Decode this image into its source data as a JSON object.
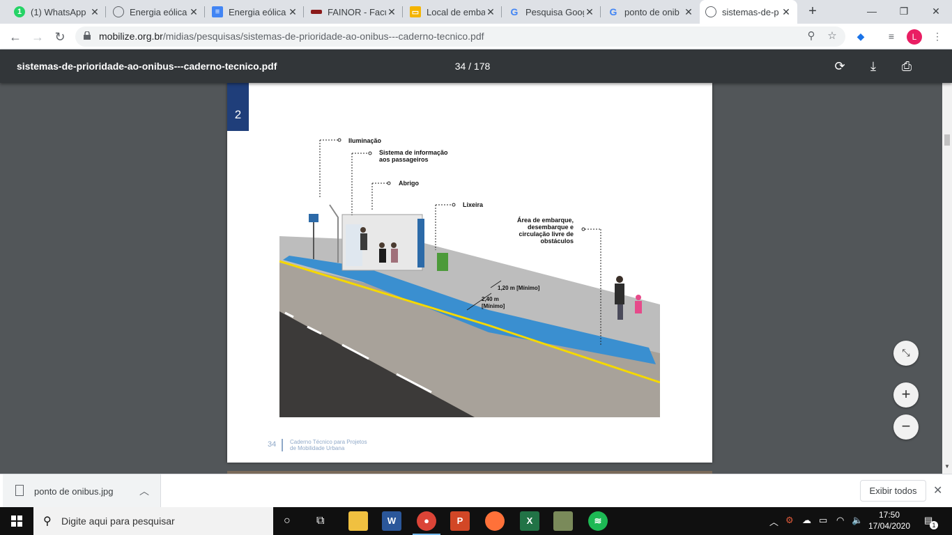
{
  "tabs": [
    {
      "title": "(1) WhatsApp",
      "icon": "whatsapp-icon",
      "color": "#25d366",
      "badge": "1"
    },
    {
      "title": "Energia eólica",
      "icon": "globe-icon",
      "color": "#5f6368",
      "badge": ""
    },
    {
      "title": "Energia eólica",
      "icon": "docs-icon",
      "color": "#4285f4",
      "badge": ""
    },
    {
      "title": "FAINOR - Facu",
      "icon": "fainor-icon",
      "color": "#8b1a1a",
      "badge": ""
    },
    {
      "title": "Local de emba",
      "icon": "slides-icon",
      "color": "#f4b400",
      "badge": ""
    },
    {
      "title": "Pesquisa Goog",
      "icon": "google-icon",
      "color": "#4285f4",
      "badge": ""
    },
    {
      "title": "ponto de onib",
      "icon": "google-icon",
      "color": "#4285f4",
      "badge": ""
    },
    {
      "title": "sistemas-de-p",
      "icon": "globe-icon",
      "color": "#5f6368",
      "badge": ""
    }
  ],
  "address": {
    "domain": "mobilize.org.br",
    "path": "/midias/pesquisas/sistemas-de-prioridade-ao-onibus---caderno-tecnico.pdf"
  },
  "avatar_letter": "L",
  "pdf": {
    "title": "sistemas-de-prioridade-ao-onibus---caderno-tecnico.pdf",
    "page_indicator": "34 / 178"
  },
  "document": {
    "chapter": "2",
    "labels": {
      "iluminacao": "Iluminação",
      "sistema_l1": "Sistema de informação",
      "sistema_l2": "aos passageiros",
      "abrigo": "Abrigo",
      "lixeira": "Lixeira",
      "area_l1": "Área de embarque,",
      "area_l2": "desembarque e",
      "area_l3": "circulação livre de",
      "area_l4": "obstáculos",
      "dim1": "1,20 m [Mínimo]",
      "dim2_l1": "2,40 m",
      "dim2_l2": "[Mínimo]"
    },
    "page_number": "34",
    "footer_l1": "Caderno Técnico para Projetos",
    "footer_l2": "de Mobilidade Urbana"
  },
  "download": {
    "filename": "ponto de onibus.jpg",
    "show_all": "Exibir todos"
  },
  "taskbar": {
    "search_placeholder": "Digite aqui para pesquisar",
    "time": "17:50",
    "date": "17/04/2020",
    "notification_count": "1"
  },
  "colors": {
    "platform_blue": "#3a8fd0",
    "curb_yellow": "#f5d800",
    "chapter_blue": "#1f3e7a"
  }
}
